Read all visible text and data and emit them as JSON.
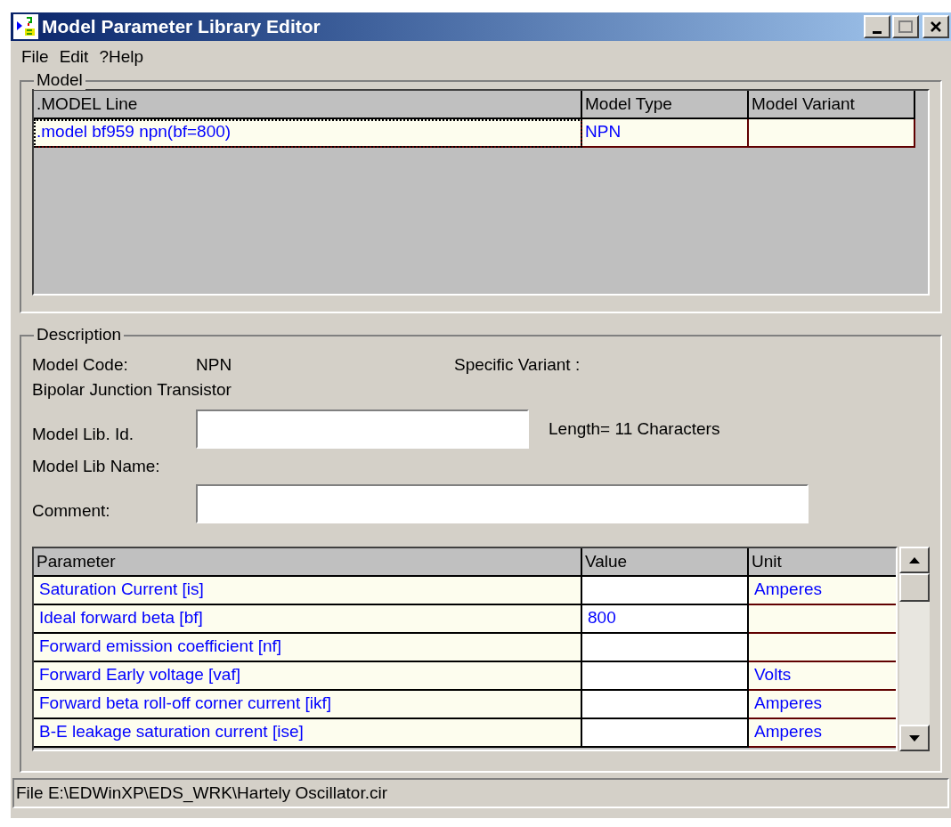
{
  "window": {
    "title": "Model Parameter Library Editor"
  },
  "menu": [
    "File",
    "Edit",
    "?Help"
  ],
  "model": {
    "label": "Model",
    "columns": [
      ".MODEL Line",
      "Model Type",
      "Model Variant"
    ],
    "rows": [
      {
        "cells": [
          ".model bf959 npn(bf=800)",
          "NPN",
          ""
        ],
        "selected": true
      }
    ]
  },
  "description": {
    "label": "Description",
    "model_code_label": "Model Code:",
    "model_code": "NPN",
    "specific_variant_label": "Specific Variant :",
    "device": "Bipolar Junction Transistor",
    "lib_id_label": "Model Lib. Id.",
    "length_note": "Length= 11 Characters",
    "lib_name_label": "Model Lib Name:",
    "comment_label": "Comment:"
  },
  "parameters": {
    "columns": [
      "Parameter",
      "Value",
      "Unit"
    ],
    "rows": [
      {
        "parameter": "Saturation Current [is]",
        "value": "",
        "unit": "Amperes"
      },
      {
        "parameter": "Ideal forward beta [bf]",
        "value": "800",
        "unit": ""
      },
      {
        "parameter": "Forward emission coefficient [nf]",
        "value": "",
        "unit": ""
      },
      {
        "parameter": "Forward Early voltage [vaf]",
        "value": "",
        "unit": "Volts"
      },
      {
        "parameter": "Forward beta roll-off corner current [ikf]",
        "value": "",
        "unit": "Amperes"
      },
      {
        "parameter": "B-E leakage saturation current [ise]",
        "value": "",
        "unit": "Amperes"
      }
    ]
  },
  "status_bar": "File E:\\EDWinXP\\EDS_WRK\\Hartely Oscillator.cir"
}
